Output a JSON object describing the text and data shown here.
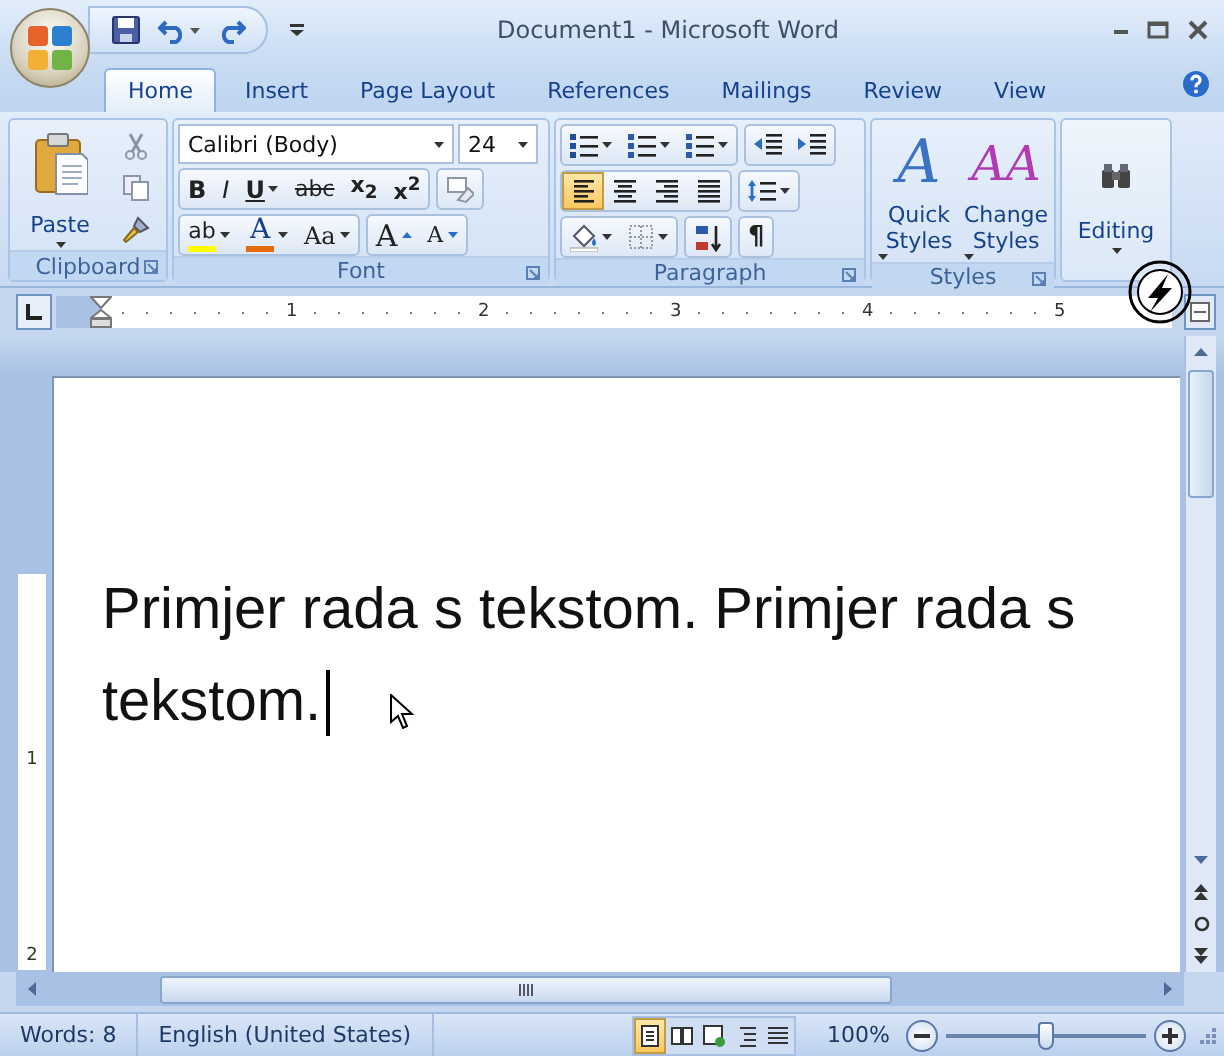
{
  "window": {
    "title": "Document1 - Microsoft Word"
  },
  "tabs": [
    {
      "label": "Home",
      "selected": true
    },
    {
      "label": "Insert",
      "selected": false
    },
    {
      "label": "Page Layout",
      "selected": false
    },
    {
      "label": "References",
      "selected": false
    },
    {
      "label": "Mailings",
      "selected": false
    },
    {
      "label": "Review",
      "selected": false
    },
    {
      "label": "View",
      "selected": false
    }
  ],
  "ribbon": {
    "clipboard": {
      "title": "Clipboard",
      "paste": "Paste"
    },
    "font": {
      "title": "Font",
      "font_name": "Calibri (Body)",
      "font_size": "24",
      "format_buttons": [
        {
          "kind": "bold",
          "label": "B"
        },
        {
          "kind": "italic",
          "label": "I"
        },
        {
          "kind": "underline",
          "label": "U"
        },
        {
          "kind": "strikethrough",
          "label": "abc"
        },
        {
          "kind": "subscript",
          "label": "x$_{2}$"
        },
        {
          "kind": "superscript",
          "label": "x$^{2}$"
        }
      ],
      "color_buttons": [
        {
          "kind": "highlight",
          "label": "ab",
          "color": "#ffff00"
        },
        {
          "kind": "font_color",
          "label": "A",
          "color": "#e46c0a"
        }
      ],
      "case_button": "Aa",
      "grow_button": "A",
      "shrink_button": "A"
    },
    "paragraph": {
      "title": "Paragraph",
      "alignment": [
        {
          "kind": "left",
          "selected": true
        },
        {
          "kind": "center",
          "selected": false
        },
        {
          "kind": "right",
          "selected": false
        },
        {
          "kind": "justify",
          "selected": false
        }
      ],
      "show_marks": "¶"
    },
    "styles": {
      "title": "Styles",
      "buttons": [
        {
          "kind": "quick",
          "glyph": "A",
          "label": "Quick Styles"
        },
        {
          "kind": "change",
          "glyph": "AA",
          "label": "Change Styles"
        }
      ]
    },
    "editing": {
      "label": "Editing"
    }
  },
  "ruler": {
    "marks": [
      "1",
      "2",
      "3",
      "4",
      "5"
    ],
    "vertical_marks": [
      "1",
      "2"
    ]
  },
  "document": {
    "lines": [
      "Primjer rada s tekstom. Primjer rada s",
      "tekstom."
    ]
  },
  "status_bar": {
    "words": "Words: 8",
    "language": "English (United States)",
    "views": [
      {
        "kind": "print",
        "selected": true
      },
      {
        "kind": "reading",
        "selected": false
      },
      {
        "kind": "web",
        "selected": false
      },
      {
        "kind": "outline",
        "selected": false
      },
      {
        "kind": "draft",
        "selected": false
      }
    ],
    "zoom": "100%",
    "zoom_slider": {
      "level": 0.5
    }
  }
}
